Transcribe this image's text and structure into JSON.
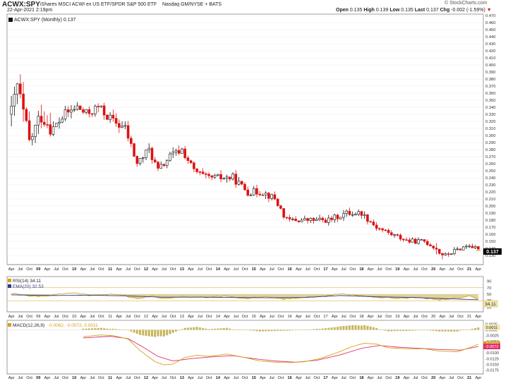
{
  "header": {
    "symbol": "ACWX:SPY",
    "description": "iShares MSCI ACWI ex US ETF/SPDR S&P 500 ETF",
    "exchange": "Nasdaq GM/NYSE + BATS",
    "date": "22-Apr-2021 2:19pm",
    "copyright": "© StockCharts.com",
    "open_label": "Open",
    "open_value": "0.135",
    "high_label": "High",
    "high_value": "0.139",
    "low_label": "Low",
    "low_value": "0.135",
    "last_label": "Last",
    "last_value": "0.137",
    "chg_label": "Chg",
    "chg_value": "-0.002 (-1.59%)",
    "chg_arrow": "▼"
  },
  "colors": {
    "up": "#111111",
    "down": "#dd1111",
    "rsi_line": "#d4a017",
    "ema_line": "#2a3a8c",
    "macd_line": "#d4a017",
    "signal_line": "#e0306a",
    "histogram": "#c9b458",
    "last_badge": "#000000"
  },
  "chart_data": [
    {
      "type": "candlestick",
      "title": "ACWX:SPY (Monthly) 0.137",
      "ylim": [
        0.12,
        0.47
      ],
      "yticks": [
        0.13,
        0.14,
        0.15,
        0.16,
        0.17,
        0.18,
        0.19,
        0.2,
        0.21,
        0.22,
        0.23,
        0.24,
        0.25,
        0.26,
        0.27,
        0.28,
        0.29,
        0.3,
        0.31,
        0.32,
        0.33,
        0.34,
        0.35,
        0.36,
        0.37,
        0.38,
        0.39,
        0.4,
        0.41,
        0.42,
        0.43,
        0.44,
        0.45,
        0.46,
        0.47
      ],
      "last_value": "0.137",
      "x_range": [
        "2008-04",
        "2021-04"
      ],
      "anchors": [
        [
          "2008-04",
          0.33
        ],
        [
          "2008-06",
          0.37
        ],
        [
          "2008-10",
          0.29
        ],
        [
          "2009-02",
          0.33
        ],
        [
          "2009-06",
          0.31
        ],
        [
          "2009-10",
          0.33
        ],
        [
          "2010-02",
          0.34
        ],
        [
          "2010-05",
          0.33
        ],
        [
          "2010-09",
          0.34
        ],
        [
          "2011-02",
          0.32
        ],
        [
          "2011-06",
          0.31
        ],
        [
          "2011-10",
          0.26
        ],
        [
          "2012-02",
          0.28
        ],
        [
          "2012-05",
          0.25
        ],
        [
          "2012-09",
          0.27
        ],
        [
          "2013-01",
          0.28
        ],
        [
          "2013-05",
          0.25
        ],
        [
          "2013-09",
          0.24
        ],
        [
          "2014-01",
          0.24
        ],
        [
          "2014-06",
          0.24
        ],
        [
          "2014-11",
          0.22
        ],
        [
          "2015-04",
          0.22
        ],
        [
          "2015-08",
          0.21
        ],
        [
          "2015-12",
          0.18
        ],
        [
          "2016-06",
          0.18
        ],
        [
          "2016-09",
          0.18
        ],
        [
          "2017-02",
          0.18
        ],
        [
          "2017-08",
          0.19
        ],
        [
          "2018-01",
          0.19
        ],
        [
          "2018-06",
          0.17
        ],
        [
          "2018-11",
          0.16
        ],
        [
          "2019-05",
          0.15
        ],
        [
          "2019-10",
          0.15
        ],
        [
          "2020-02",
          0.14
        ],
        [
          "2020-03",
          0.135
        ],
        [
          "2020-05",
          0.13
        ],
        [
          "2020-10",
          0.14
        ],
        [
          "2021-01",
          0.145
        ],
        [
          "2021-04",
          0.137
        ]
      ],
      "x_tick_labels": [
        "Apr",
        "Jul",
        "Oct",
        "09",
        "Apr",
        "Jul",
        "Oct",
        "10",
        "Apr",
        "Jul",
        "Oct",
        "11",
        "Apr",
        "Jul",
        "Oct",
        "12",
        "Apr",
        "Jul",
        "Oct",
        "13",
        "Apr",
        "Jul",
        "Oct",
        "14",
        "Apr",
        "Jul",
        "Oct",
        "15",
        "Apr",
        "Jul",
        "Oct",
        "16",
        "Apr",
        "Jul",
        "Oct",
        "17",
        "Apr",
        "Jul",
        "Oct",
        "18",
        "Apr",
        "Jul",
        "Oct",
        "19",
        "Apr",
        "Jul",
        "Oct",
        "20",
        "Apr",
        "Jul",
        "Oct",
        "21",
        "Apr"
      ]
    },
    {
      "type": "line",
      "title": "RSI(14) 34.11",
      "ema_label": "EMA(20) 32.53",
      "ylim": [
        0,
        100
      ],
      "yticks": [
        10,
        30,
        50,
        70,
        90
      ],
      "levels": [
        30,
        70
      ],
      "last_value": "34.11",
      "rsi_anchors": [
        [
          "2008-04",
          52
        ],
        [
          "2009-01",
          42
        ],
        [
          "2009-06",
          48
        ],
        [
          "2010-01",
          55
        ],
        [
          "2010-06",
          46
        ],
        [
          "2011-04",
          50
        ],
        [
          "2011-10",
          36
        ],
        [
          "2012-03",
          44
        ],
        [
          "2012-07",
          38
        ],
        [
          "2013-01",
          42
        ],
        [
          "2013-08",
          40
        ],
        [
          "2014-03",
          44
        ],
        [
          "2014-10",
          36
        ],
        [
          "2015-04",
          43
        ],
        [
          "2015-11",
          35
        ],
        [
          "2016-05",
          40
        ],
        [
          "2016-12",
          42
        ],
        [
          "2017-06",
          52
        ],
        [
          "2017-09",
          48
        ],
        [
          "2018-01",
          46
        ],
        [
          "2018-07",
          40
        ],
        [
          "2019-01",
          38
        ],
        [
          "2019-08",
          40
        ],
        [
          "2020-03",
          33
        ],
        [
          "2020-09",
          38
        ],
        [
          "2021-01",
          44
        ],
        [
          "2021-04",
          34
        ]
      ],
      "ema_anchors": [
        [
          "2008-04",
          48
        ],
        [
          "2009-06",
          46
        ],
        [
          "2010-06",
          47
        ],
        [
          "2011-06",
          45
        ],
        [
          "2012-06",
          41
        ],
        [
          "2013-06",
          41
        ],
        [
          "2014-06",
          40
        ],
        [
          "2015-06",
          39
        ],
        [
          "2016-06",
          40
        ],
        [
          "2017-06",
          46
        ],
        [
          "2018-06",
          42
        ],
        [
          "2019-06",
          40
        ],
        [
          "2020-06",
          36
        ],
        [
          "2021-04",
          33
        ]
      ]
    },
    {
      "type": "line",
      "title": "MACD(12,26,9)",
      "values_label": "-0.0062, -0.0072, 0.0011",
      "ylim": [
        -0.0185,
        0.0035
      ],
      "yticks": [
        0.0025,
        0,
        -0.0025,
        -0.005,
        -0.0075,
        -0.01,
        -0.0125,
        -0.015,
        -0.0175
      ],
      "ytick_labels": [
        "0.0025",
        "0.0000",
        "-0.0025",
        "-0.0050",
        "-0.0075",
        "-0.0100",
        "-0.0125",
        "-0.0150",
        "-0.0175"
      ],
      "last_values": [
        "0.0011",
        "-0.0062",
        "-0.0072"
      ],
      "macd_anchors": [
        [
          "2010-04",
          -0.003
        ],
        [
          "2010-10",
          -0.0022
        ],
        [
          "2011-02",
          -0.0025
        ],
        [
          "2011-07",
          -0.004
        ],
        [
          "2011-11",
          -0.009
        ],
        [
          "2012-04",
          -0.0138
        ],
        [
          "2012-07",
          -0.0152
        ],
        [
          "2012-10",
          -0.0148
        ],
        [
          "2013-02",
          -0.012
        ],
        [
          "2013-06",
          -0.011
        ],
        [
          "2013-10",
          -0.0115
        ],
        [
          "2014-04",
          -0.0105
        ],
        [
          "2014-10",
          -0.012
        ],
        [
          "2015-03",
          -0.0135
        ],
        [
          "2015-08",
          -0.014
        ],
        [
          "2016-01",
          -0.0142
        ],
        [
          "2016-06",
          -0.0138
        ],
        [
          "2016-11",
          -0.0125
        ],
        [
          "2017-05",
          -0.0098
        ],
        [
          "2017-10",
          -0.0072
        ],
        [
          "2018-02",
          -0.0058
        ],
        [
          "2018-06",
          -0.0062
        ],
        [
          "2018-10",
          -0.0078
        ],
        [
          "2019-04",
          -0.0082
        ],
        [
          "2019-10",
          -0.0082
        ],
        [
          "2020-03",
          -0.0092
        ],
        [
          "2020-09",
          -0.0095
        ],
        [
          "2021-01",
          -0.0078
        ],
        [
          "2021-04",
          -0.0062
        ]
      ],
      "signal_anchors": [
        [
          "2010-04",
          -0.0035
        ],
        [
          "2011-01",
          -0.0028
        ],
        [
          "2011-07",
          -0.0038
        ],
        [
          "2011-12",
          -0.0075
        ],
        [
          "2012-05",
          -0.0115
        ],
        [
          "2012-10",
          -0.0135
        ],
        [
          "2013-04",
          -0.0125
        ],
        [
          "2013-10",
          -0.0118
        ],
        [
          "2014-06",
          -0.0112
        ],
        [
          "2015-01",
          -0.0125
        ],
        [
          "2015-08",
          -0.0135
        ],
        [
          "2016-03",
          -0.014
        ],
        [
          "2016-10",
          -0.0132
        ],
        [
          "2017-06",
          -0.0108
        ],
        [
          "2018-01",
          -0.008
        ],
        [
          "2018-07",
          -0.0068
        ],
        [
          "2019-01",
          -0.0075
        ],
        [
          "2019-08",
          -0.008
        ],
        [
          "2020-03",
          -0.0085
        ],
        [
          "2020-10",
          -0.0088
        ],
        [
          "2021-04",
          -0.0072
        ]
      ]
    }
  ]
}
